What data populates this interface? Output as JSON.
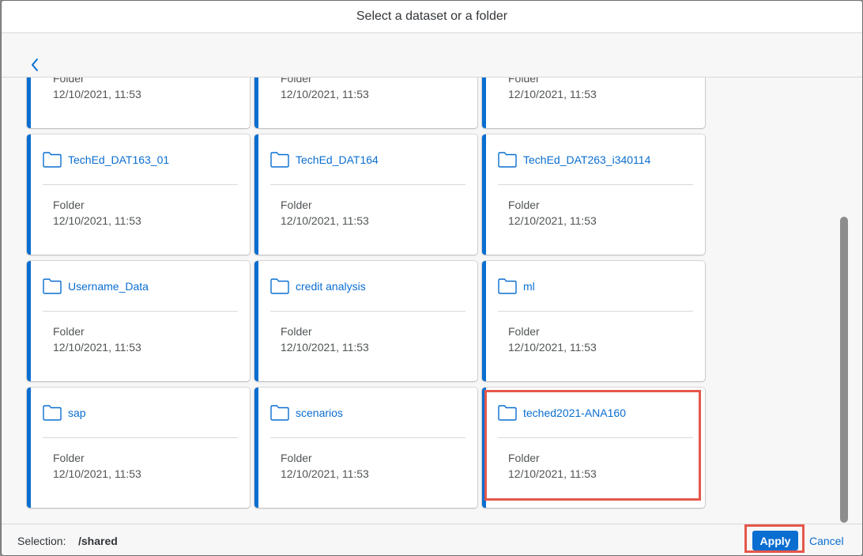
{
  "dialog": {
    "title": "Select a dataset or a folder"
  },
  "folders": [
    {
      "name": "",
      "type": "Folder",
      "date": "12/10/2021, 11:53"
    },
    {
      "name": "",
      "type": "Folder",
      "date": "12/10/2021, 11:53"
    },
    {
      "name": "",
      "type": "Folder",
      "date": "12/10/2021, 11:53"
    },
    {
      "name": "TechEd_DAT163_01",
      "type": "Folder",
      "date": "12/10/2021, 11:53"
    },
    {
      "name": "TechEd_DAT164",
      "type": "Folder",
      "date": "12/10/2021, 11:53"
    },
    {
      "name": "TechEd_DAT263_i340114",
      "type": "Folder",
      "date": "12/10/2021, 11:53"
    },
    {
      "name": "Username_Data",
      "type": "Folder",
      "date": "12/10/2021, 11:53"
    },
    {
      "name": "credit analysis",
      "type": "Folder",
      "date": "12/10/2021, 11:53"
    },
    {
      "name": "ml",
      "type": "Folder",
      "date": "12/10/2021, 11:53"
    },
    {
      "name": "sap",
      "type": "Folder",
      "date": "12/10/2021, 11:53"
    },
    {
      "name": "scenarios",
      "type": "Folder",
      "date": "12/10/2021, 11:53"
    },
    {
      "name": "teched2021-ANA160",
      "type": "Folder",
      "date": "12/10/2021, 11:53"
    }
  ],
  "footer": {
    "selection_label": "Selection:",
    "selection_value": "/shared",
    "apply_label": "Apply",
    "cancel_label": "Cancel"
  },
  "colors": {
    "accent": "#0a6ed1",
    "highlight": "#e5574b"
  },
  "icons": {
    "back": "chevron-left-icon",
    "folder": "folder-icon"
  }
}
